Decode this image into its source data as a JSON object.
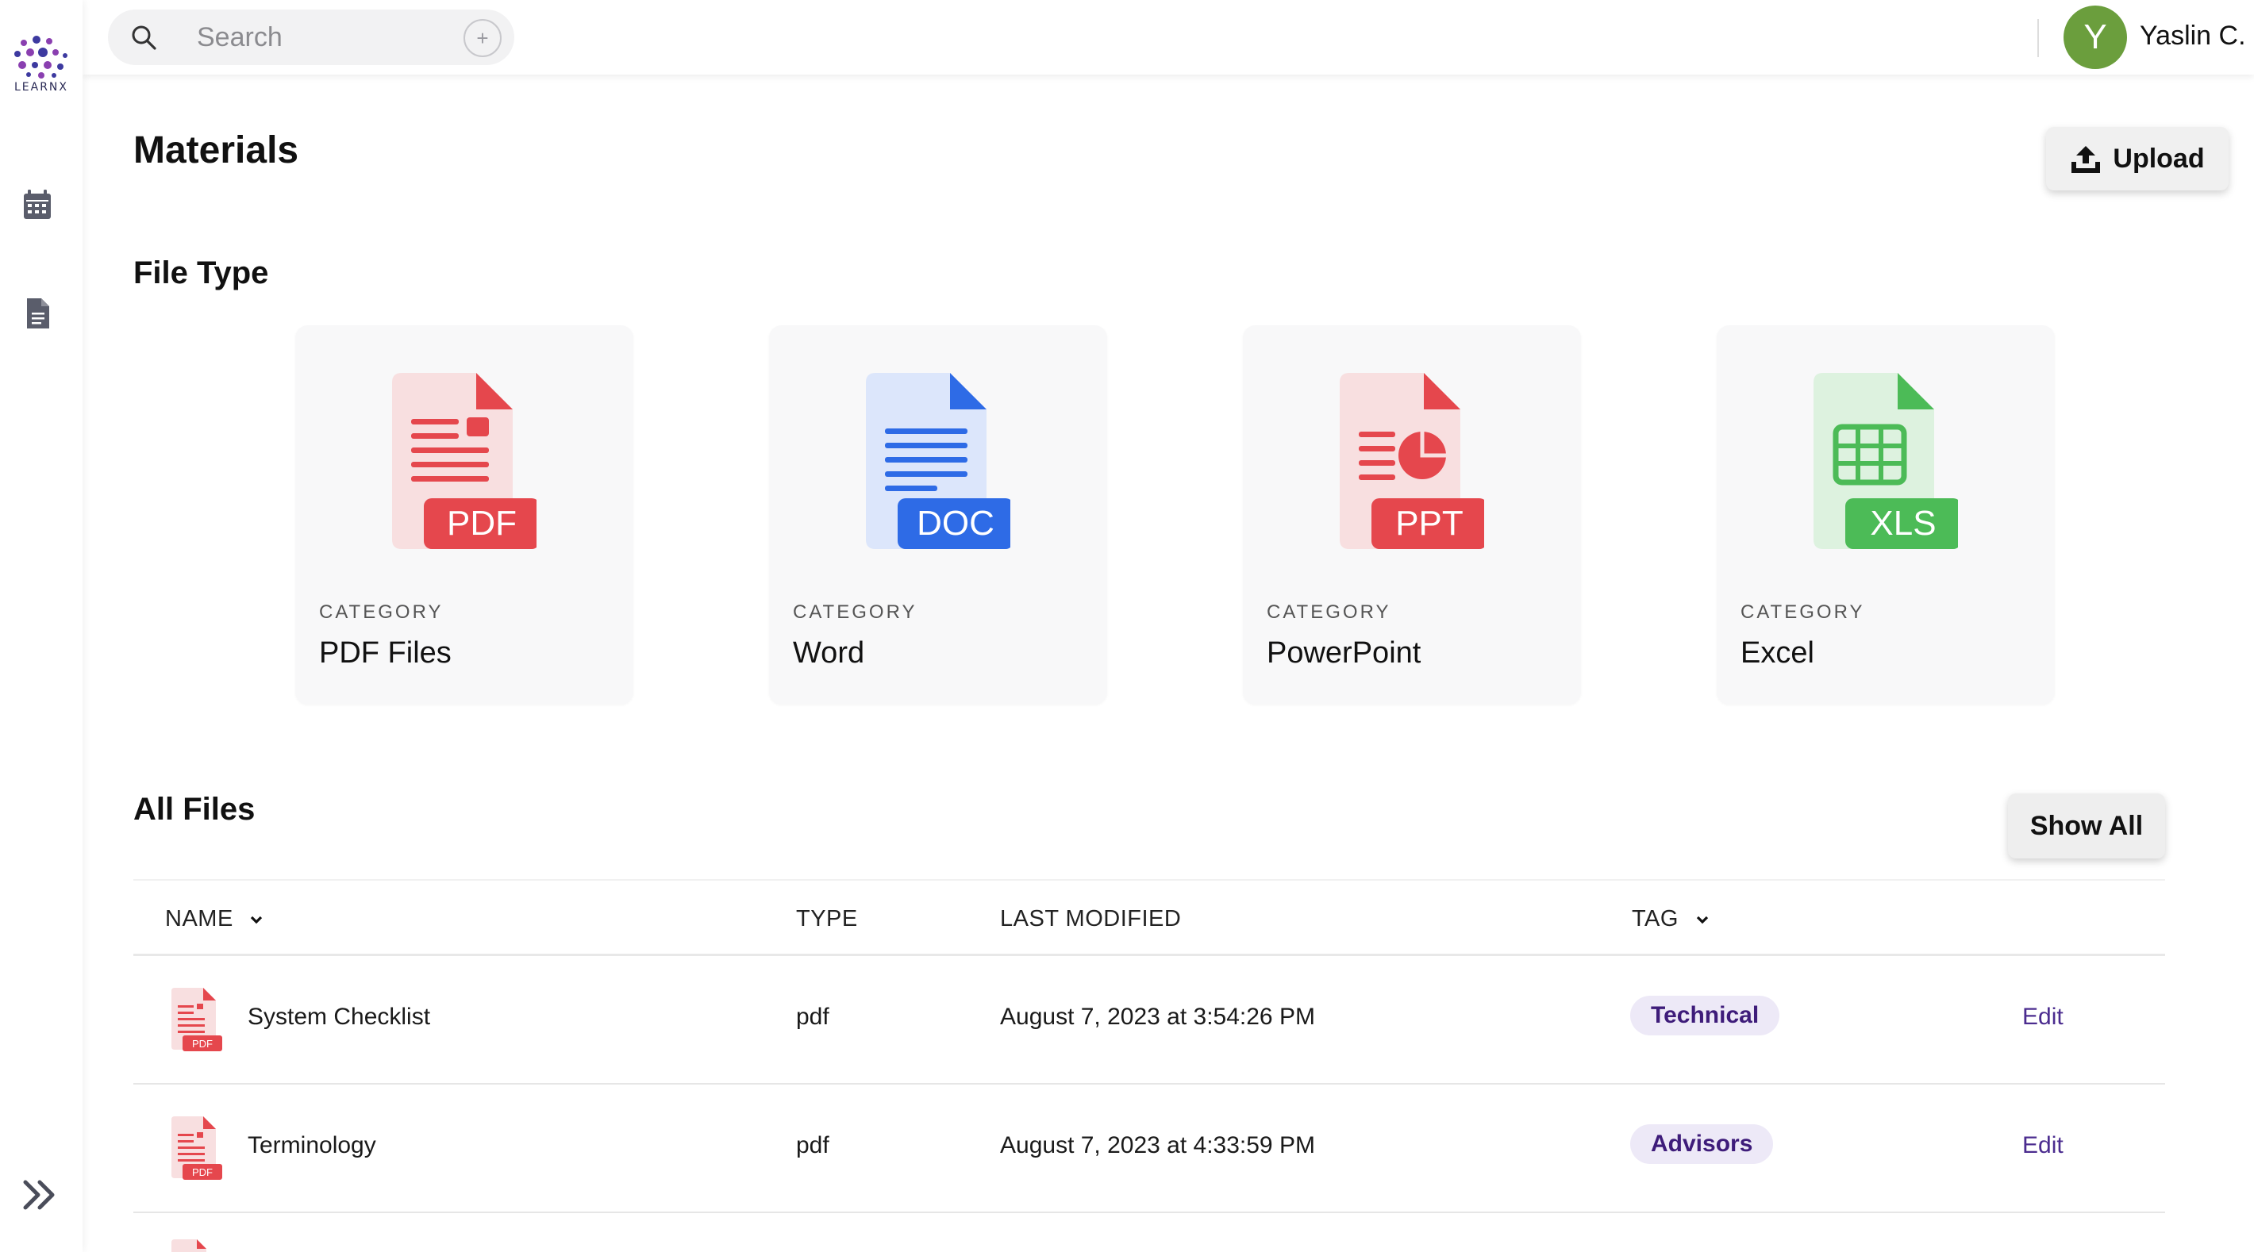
{
  "app": {
    "logo_text": "LEARNX"
  },
  "header": {
    "search_placeholder": "Search",
    "add_symbol": "+",
    "user": {
      "initial": "Y",
      "name": "Yaslin C.",
      "avatar_color": "#6b9e3d"
    }
  },
  "sidebar": {
    "items": [
      {
        "name": "calendar-icon"
      },
      {
        "name": "document-icon"
      }
    ],
    "expand_icon": "double-chevron-right-icon"
  },
  "main": {
    "title": "Materials",
    "upload_label": "Upload",
    "file_type_title": "File Type",
    "categories": [
      {
        "badge": "PDF",
        "label": "CATEGORY",
        "name": "PDF Files",
        "color": "#e5474d",
        "light": "#f8dfe0"
      },
      {
        "badge": "DOC",
        "label": "CATEGORY",
        "name": "Word",
        "color": "#2e6be6",
        "light": "#dce6fb"
      },
      {
        "badge": "PPT",
        "label": "CATEGORY",
        "name": "PowerPoint",
        "color": "#e5474d",
        "light": "#f8dfe0"
      },
      {
        "badge": "XLS",
        "label": "CATEGORY",
        "name": "Excel",
        "color": "#4cbb57",
        "light": "#ddf2df"
      }
    ],
    "all_files_title": "All Files",
    "show_all_label": "Show All",
    "table": {
      "columns": {
        "name": "NAME",
        "type": "TYPE",
        "last_modified": "LAST MODIFIED",
        "tag": "TAG"
      },
      "rows": [
        {
          "name": "System Checklist",
          "type": "pdf",
          "modified": "August 7, 2023 at 3:54:26 PM",
          "tag": "Technical",
          "action": "Edit",
          "icon_badge": "PDF"
        },
        {
          "name": "Terminology",
          "type": "pdf",
          "modified": "August 7, 2023 at 4:33:59 PM",
          "tag": "Advisors",
          "action": "Edit",
          "icon_badge": "PDF"
        }
      ]
    }
  }
}
